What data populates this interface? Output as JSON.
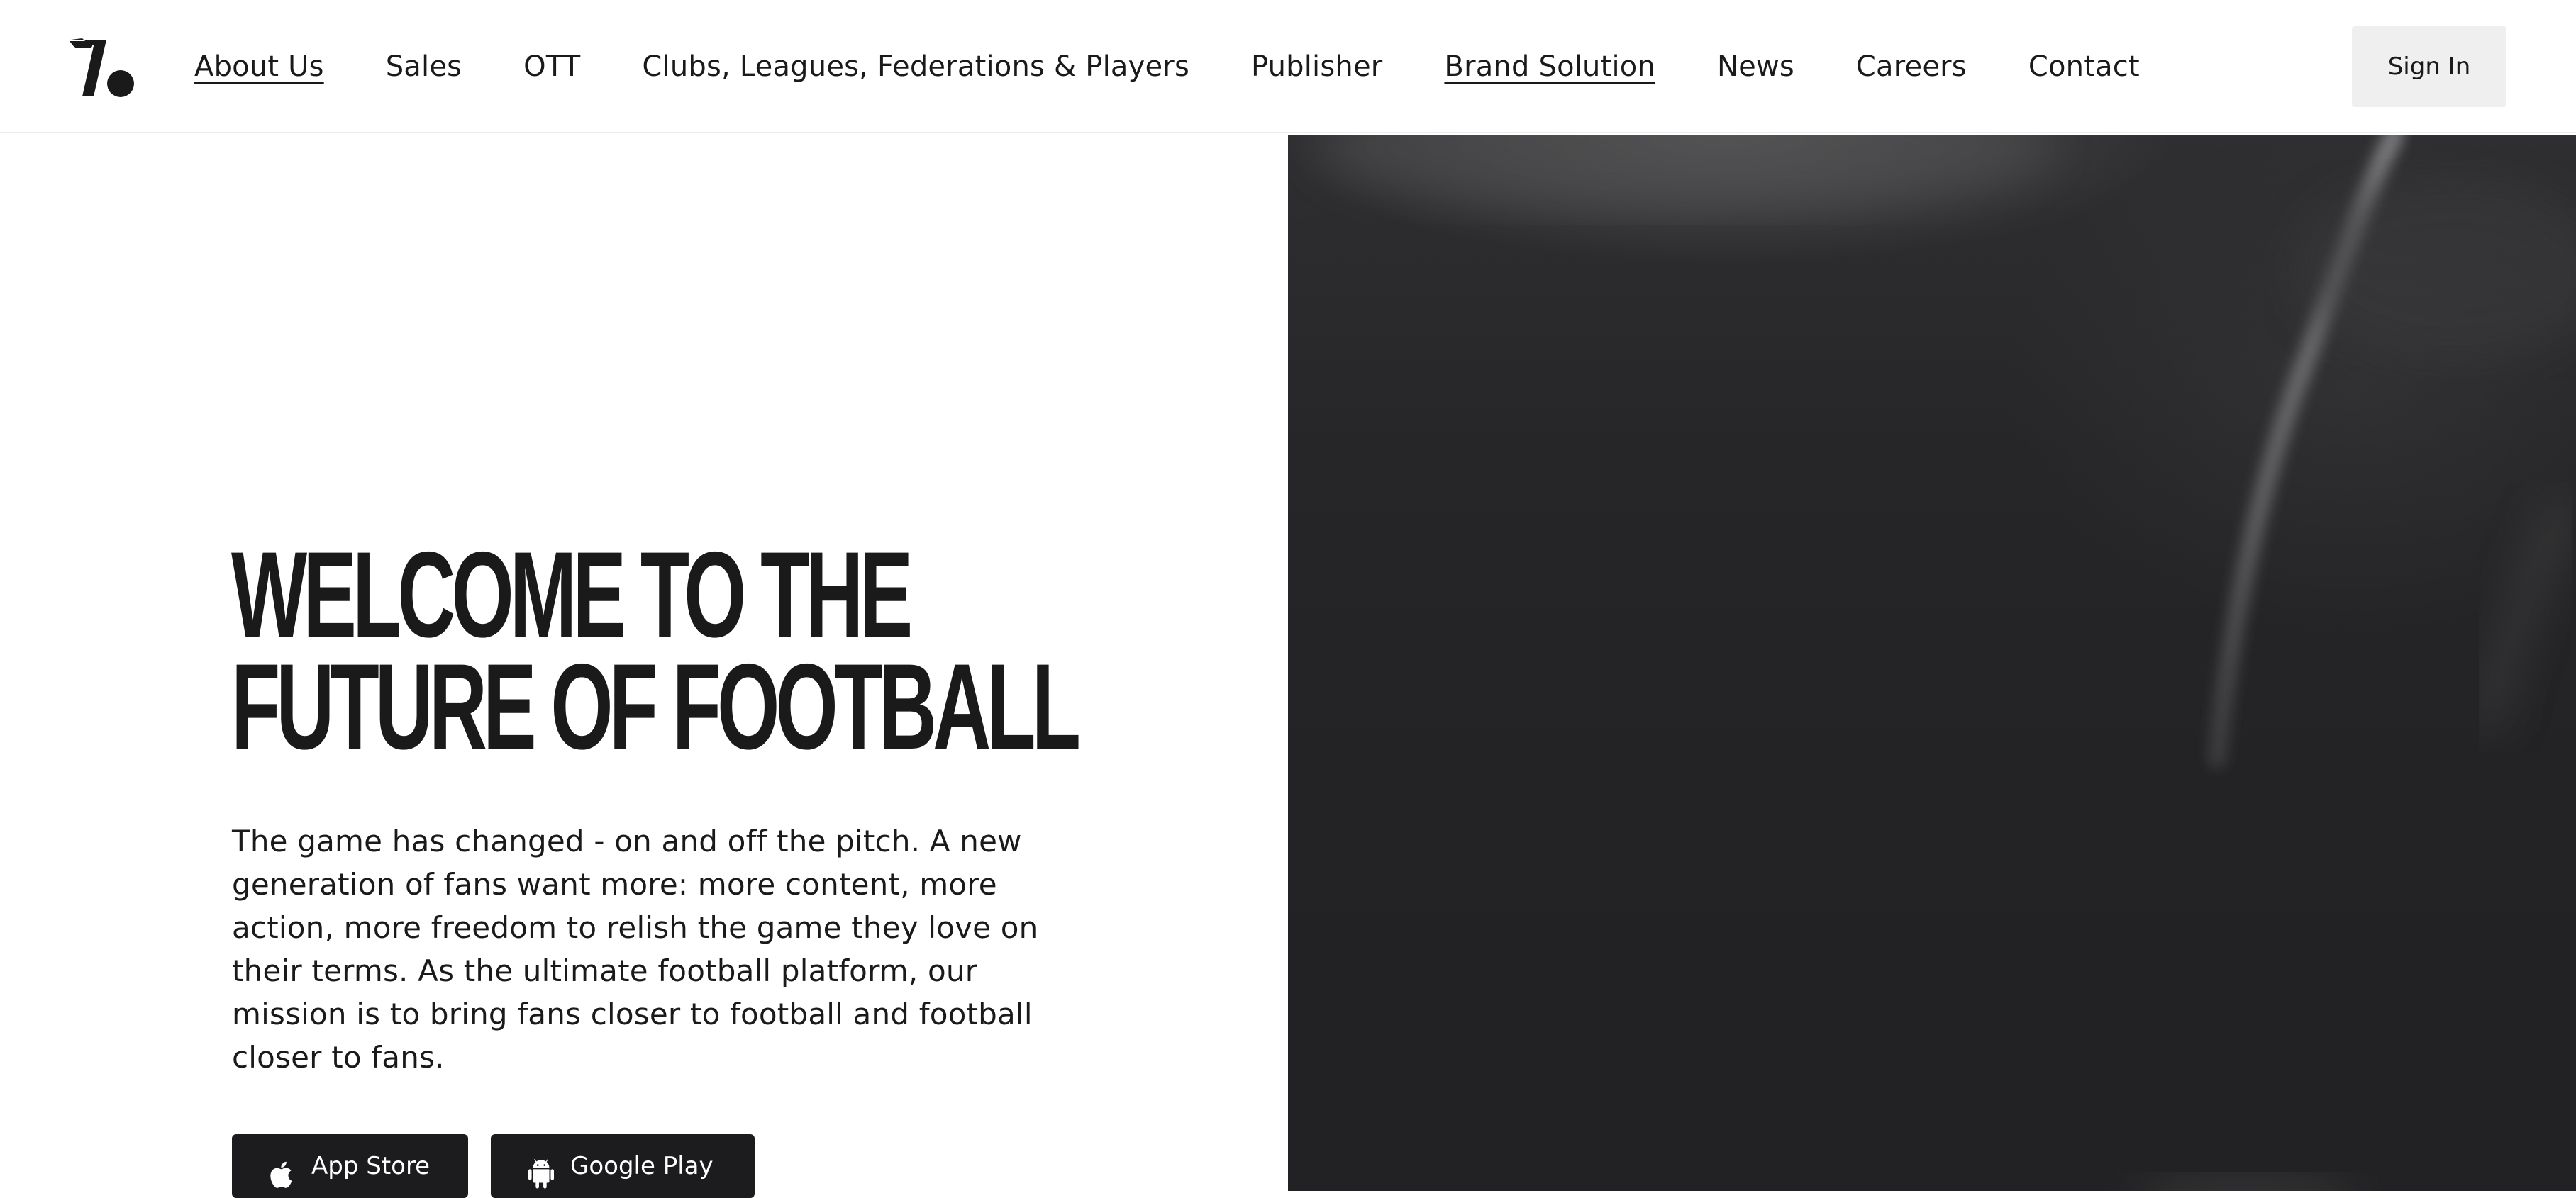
{
  "navbar": {
    "logo_icon": "onefootball-logo",
    "links": [
      {
        "label": "About Us",
        "underlined": true
      },
      {
        "label": "Sales",
        "underlined": false
      },
      {
        "label": "OTT",
        "underlined": false
      },
      {
        "label": "Clubs, Leagues, Federations & Players",
        "underlined": false
      },
      {
        "label": "Publisher",
        "underlined": false
      },
      {
        "label": "Brand Solution",
        "underlined": true
      },
      {
        "label": "News",
        "underlined": false
      },
      {
        "label": "Careers",
        "underlined": false
      },
      {
        "label": "Contact",
        "underlined": false
      }
    ],
    "sign_in_label": "Sign In"
  },
  "hero": {
    "title_line1": "WELCOME TO THE",
    "title_line2": "FUTURE OF FOOTBALL",
    "description": "The game has changed - on and off the pitch. A new generation of fans want more: more content, more action, more freedom to relish the game they love on their terms. As the ultimate football platform, our mission is to bring fans closer to football and football closer to fans.",
    "buttons": {
      "app_store": {
        "label": "App Store",
        "icon": "apple-icon"
      },
      "google_play": {
        "label": "Google Play",
        "icon": "android-icon"
      }
    }
  },
  "colors": {
    "text": "#1a1a1a",
    "button_dark": "#1c1c1e",
    "sign_in_bg": "#efefef",
    "hero_image_bg": "#242426"
  }
}
